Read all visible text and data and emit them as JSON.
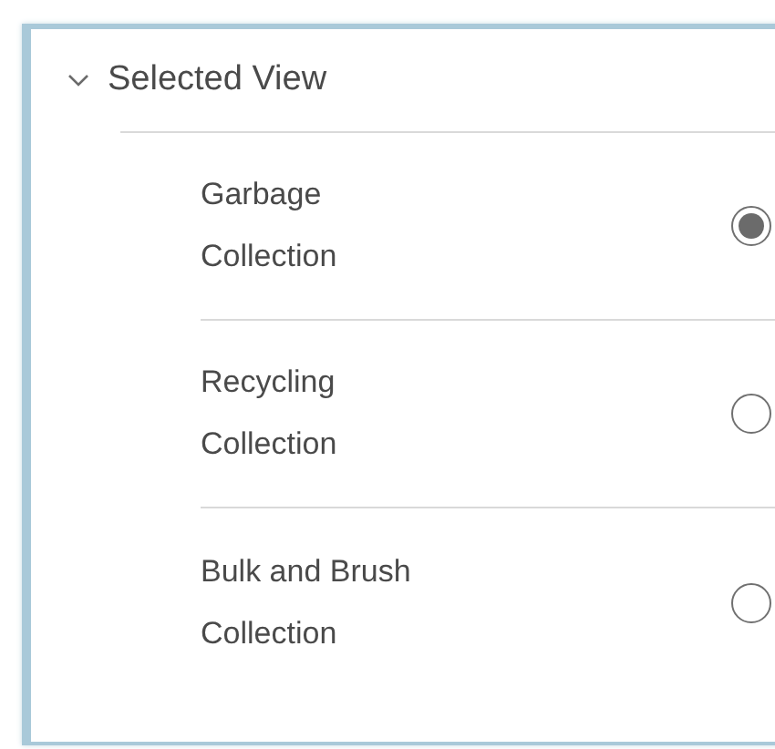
{
  "section": {
    "title": "Selected View",
    "expanded": true
  },
  "options": [
    {
      "label": "Garbage Collection",
      "selected": true
    },
    {
      "label": "Recycling Collection",
      "selected": false
    },
    {
      "label": "Bulk and Brush Collection",
      "selected": false
    }
  ]
}
